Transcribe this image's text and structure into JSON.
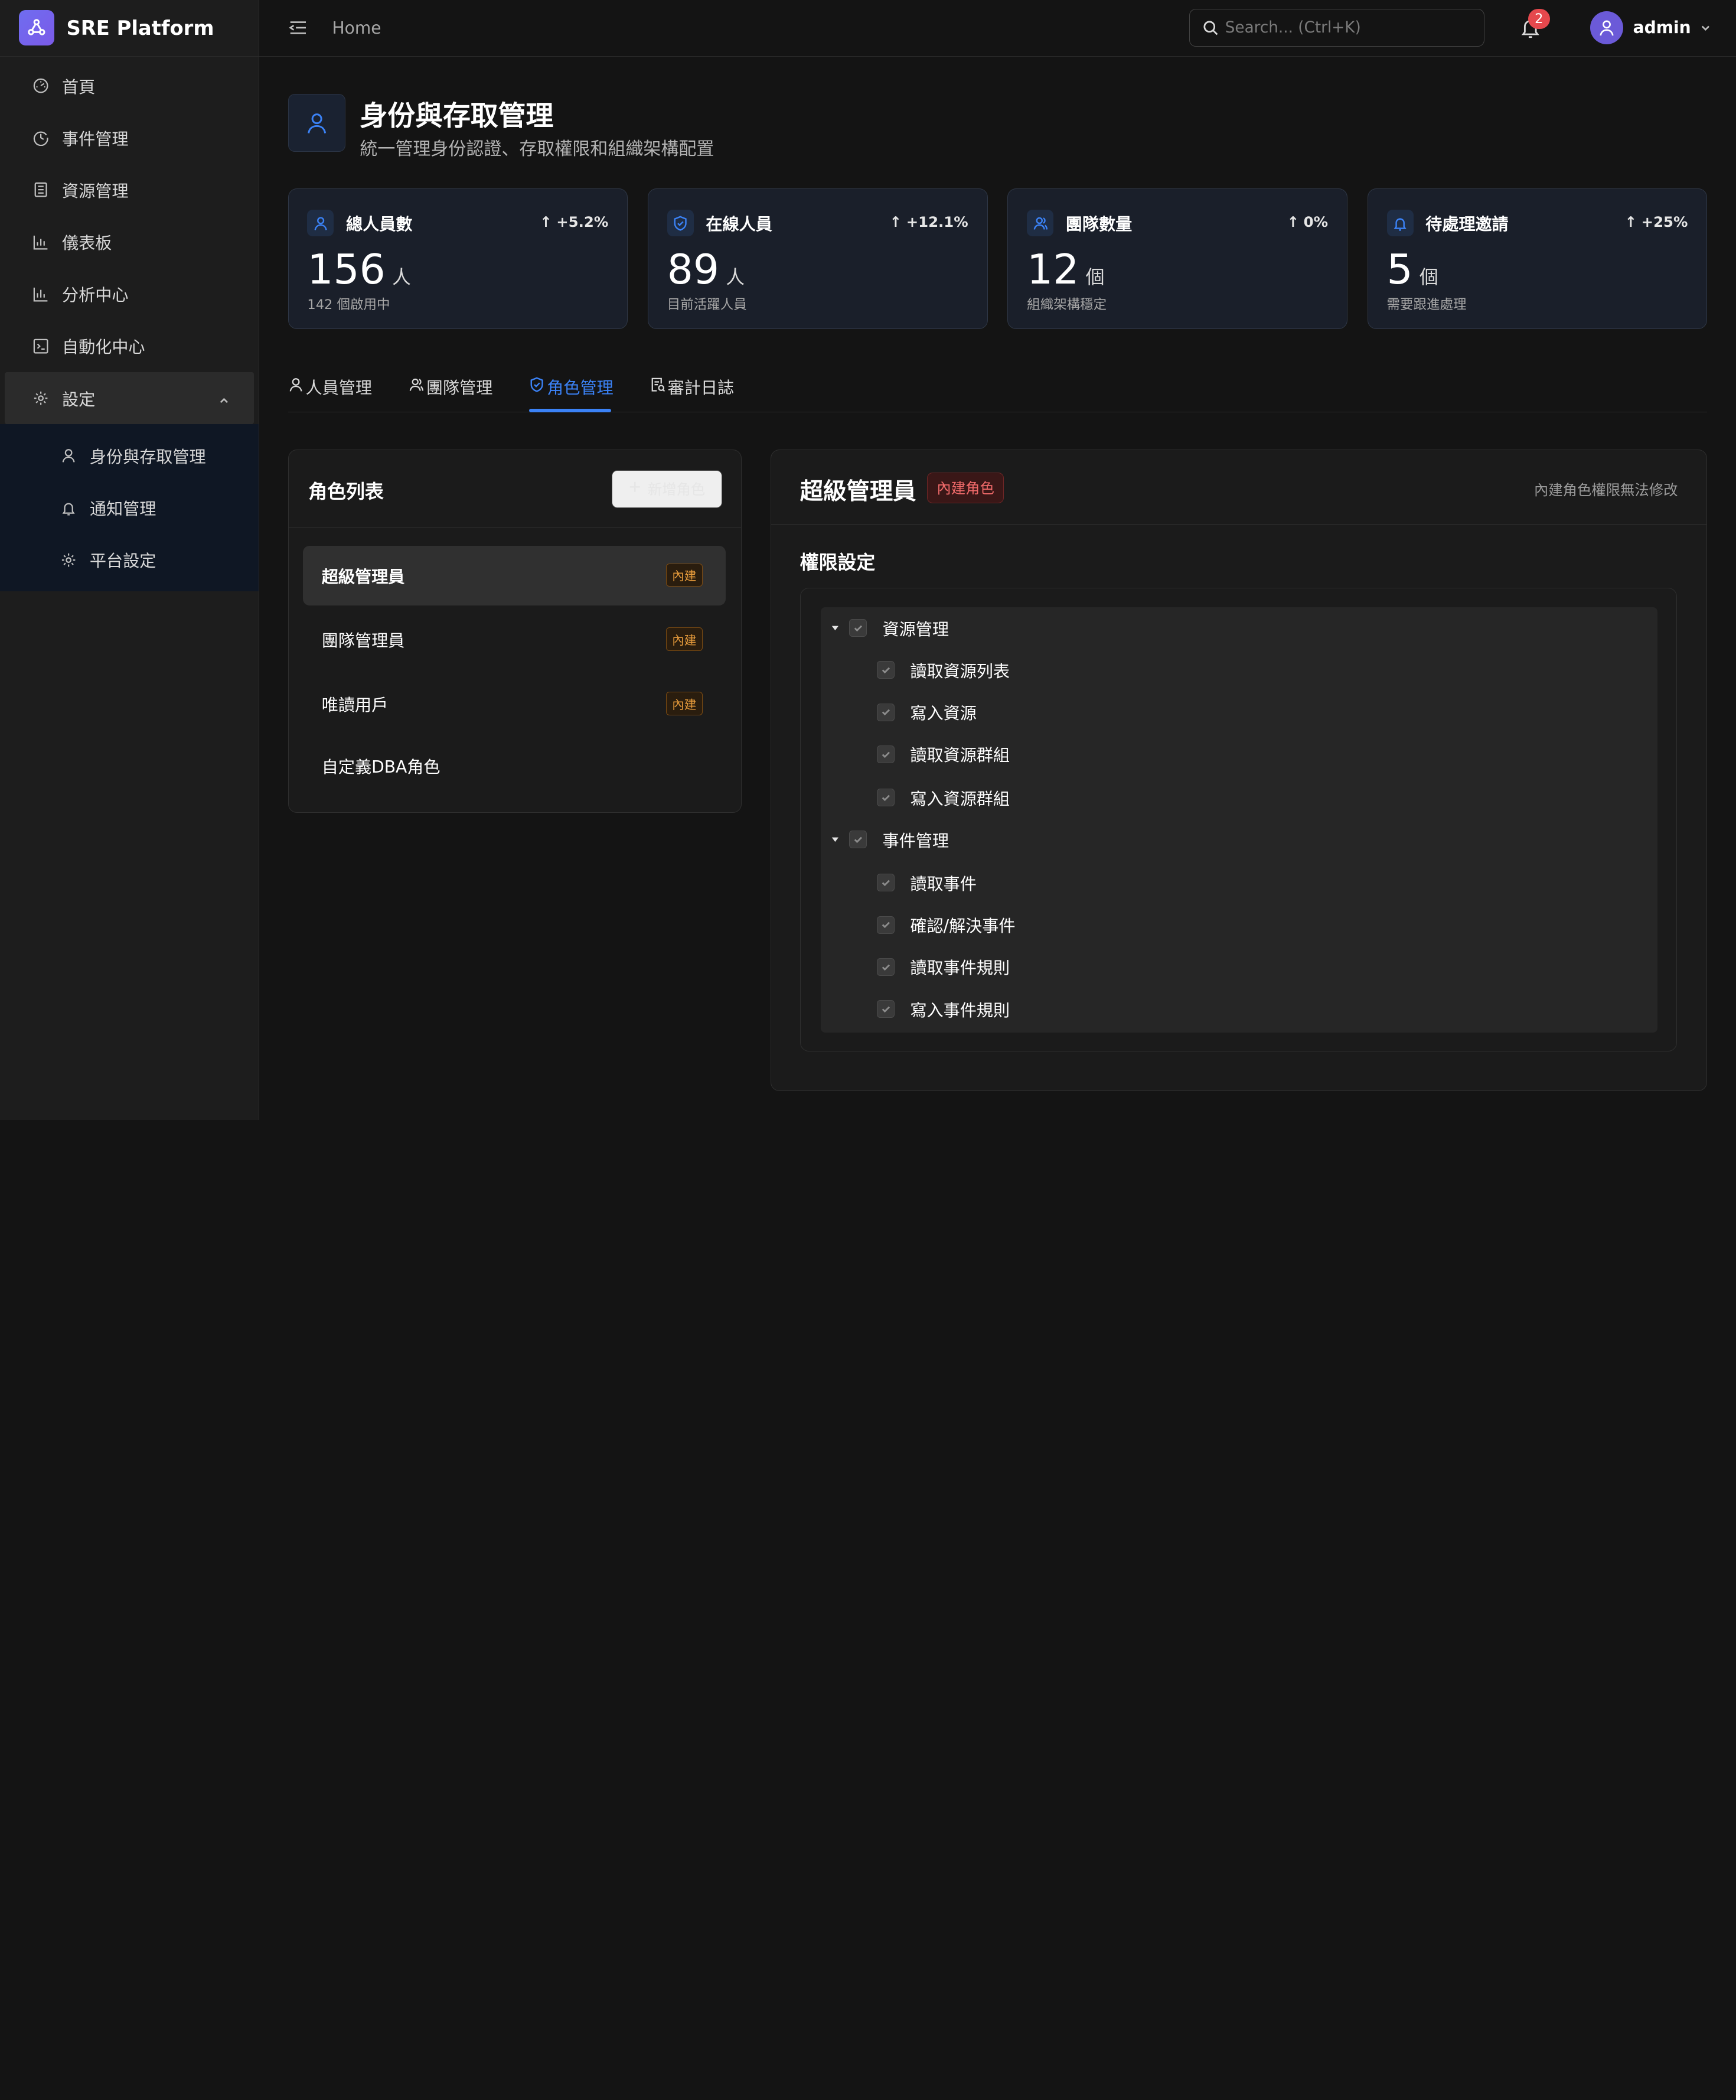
{
  "brand": {
    "name": "SRE Platform"
  },
  "sidebar": {
    "items": [
      {
        "label": "首頁",
        "icon": "dashboard-icon"
      },
      {
        "label": "事件管理",
        "icon": "clock-icon"
      },
      {
        "label": "資源管理",
        "icon": "list-icon"
      },
      {
        "label": "儀表板",
        "icon": "bar-chart-icon"
      },
      {
        "label": "分析中心",
        "icon": "bar-chart-icon"
      },
      {
        "label": "自動化中心",
        "icon": "terminal-icon"
      },
      {
        "label": "設定",
        "icon": "gear-icon",
        "expanded": true
      }
    ],
    "sub_items": [
      {
        "label": "身份與存取管理",
        "icon": "user-icon"
      },
      {
        "label": "通知管理",
        "icon": "bell-icon"
      },
      {
        "label": "平台設定",
        "icon": "gear-icon"
      }
    ]
  },
  "header": {
    "breadcrumb": "Home",
    "search_placeholder": "Search... (Ctrl+K)",
    "notification_count": "2",
    "user_name": "admin"
  },
  "page": {
    "title": "身份與存取管理",
    "subtitle": "統一管理身份認證、存取權限和組織架構配置"
  },
  "stats": [
    {
      "label": "總人員數",
      "delta": "+5.2%",
      "value": "156",
      "unit": "人",
      "note": "142 個啟用中",
      "icon": "user-icon"
    },
    {
      "label": "在線人員",
      "delta": "+12.1%",
      "value": "89",
      "unit": "人",
      "note": "目前活躍人員",
      "icon": "shield-icon"
    },
    {
      "label": "團隊數量",
      "delta": "0%",
      "value": "12",
      "unit": "個",
      "note": "組織架構穩定",
      "icon": "team-icon"
    },
    {
      "label": "待處理邀請",
      "delta": "+25%",
      "value": "5",
      "unit": "個",
      "note": "需要跟進處理",
      "icon": "bell-icon"
    }
  ],
  "tabs": [
    {
      "label": "人員管理",
      "icon": "user-icon"
    },
    {
      "label": "團隊管理",
      "icon": "team-icon"
    },
    {
      "label": "角色管理",
      "icon": "shield-icon",
      "active": true
    },
    {
      "label": "審計日誌",
      "icon": "audit-icon"
    }
  ],
  "roles": {
    "title": "角色列表",
    "add_label": "新增角色",
    "items": [
      {
        "name": "超級管理員",
        "badge": "內建",
        "selected": true
      },
      {
        "name": "團隊管理員",
        "badge": "內建"
      },
      {
        "name": "唯讀用戶",
        "badge": "內建"
      },
      {
        "name": "自定義DBA角色",
        "badge": ""
      }
    ]
  },
  "detail": {
    "title": "超級管理員",
    "badge": "內建角色",
    "note": "內建角色權限無法修改",
    "perm_title": "權限設定",
    "groups": [
      {
        "label": "資源管理",
        "children": [
          "讀取資源列表",
          "寫入資源",
          "讀取資源群組",
          "寫入資源群組"
        ]
      },
      {
        "label": "事件管理",
        "children": [
          "讀取事件",
          "確認/解決事件",
          "讀取事件規則",
          "寫入事件規則"
        ]
      }
    ]
  },
  "colors": {
    "accent": "#3b82f6",
    "badge_builtin": "#e59a3b",
    "badge_role": "#f06a6a",
    "notification": "#e5484d"
  }
}
